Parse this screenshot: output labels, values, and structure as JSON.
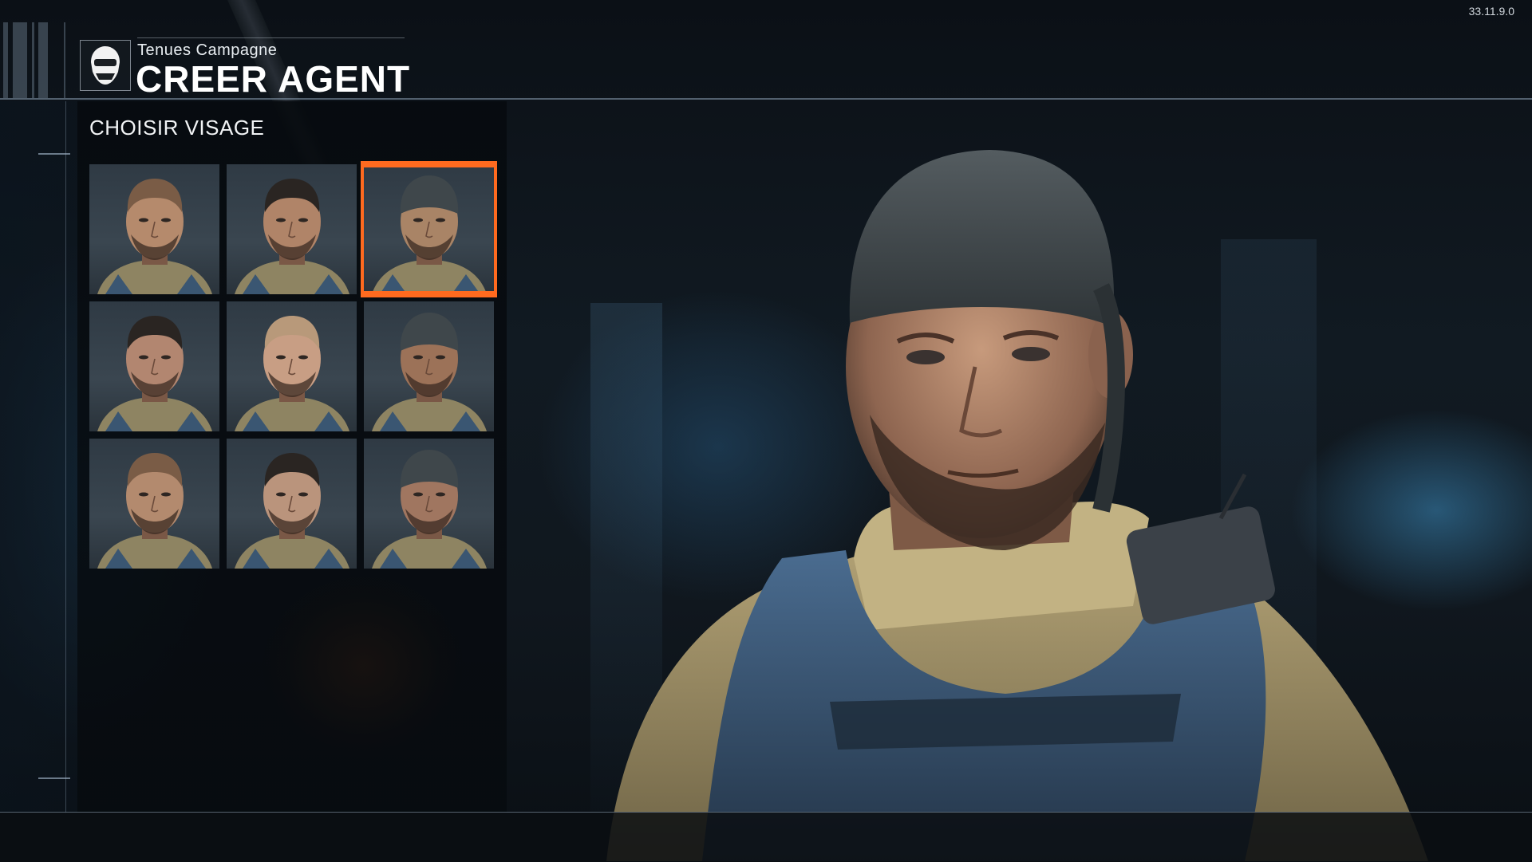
{
  "header": {
    "subtitle": "Tenues Campagne",
    "title": "CREER AGENT",
    "logo_icon": "soldier-helmet-icon"
  },
  "version": "33.11.9.0",
  "panel": {
    "section_title": "CHOISIR VISAGE",
    "selected_index": 2,
    "faces": [
      {
        "hair": "shaved",
        "skin": "#b58a6c"
      },
      {
        "hair": "dark",
        "skin": "#b08468"
      },
      {
        "hair": "bandana",
        "skin": "#a98466"
      },
      {
        "hair": "dark",
        "skin": "#b28670"
      },
      {
        "hair": "blond",
        "skin": "#c89e84"
      },
      {
        "hair": "bandana",
        "skin": "#9c7258"
      },
      {
        "hair": "shaved",
        "skin": "#b38a6e"
      },
      {
        "hair": "dark",
        "skin": "#ba947c"
      },
      {
        "hair": "bandana",
        "skin": "#a07660"
      }
    ],
    "selected_color": "#ff6a1f"
  }
}
